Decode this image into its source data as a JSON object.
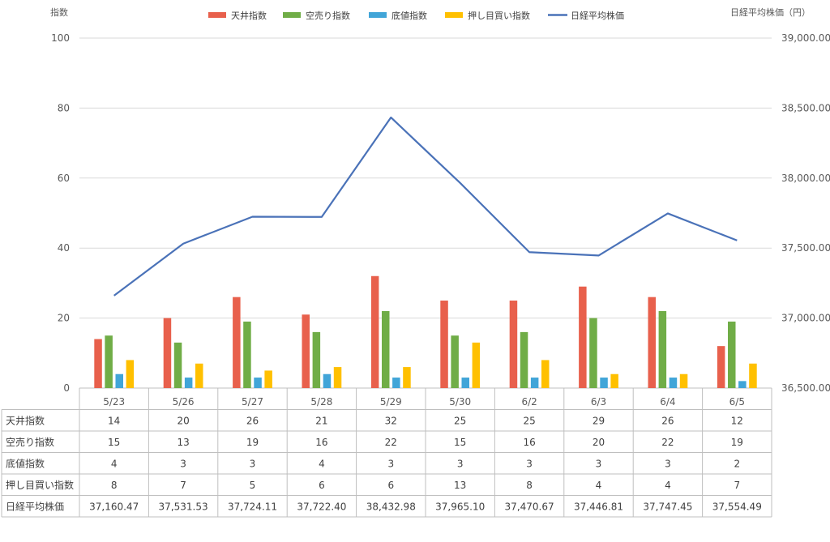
{
  "chart_data": {
    "type": "bar+line",
    "left_axis_title": "指数",
    "right_axis_title": "日経平均株価（円）",
    "categories": [
      "5/23",
      "5/26",
      "5/27",
      "5/28",
      "5/29",
      "5/30",
      "6/2",
      "6/3",
      "6/4",
      "6/5"
    ],
    "left_ylim": [
      0,
      100
    ],
    "left_ticks": [
      0,
      20,
      40,
      60,
      80,
      100
    ],
    "right_ylim": [
      36500,
      39000
    ],
    "right_ticks": [
      "36,500.00",
      "37,000.00",
      "37,500.00",
      "38,000.00",
      "38,500.00",
      "39,000.00"
    ],
    "right_tick_values": [
      36500,
      37000,
      37500,
      38000,
      38500,
      39000
    ],
    "grid": true,
    "legend_position": "top",
    "series": [
      {
        "name": "天井指数",
        "kind": "bar",
        "color": "#e8604c",
        "values": [
          14,
          20,
          26,
          21,
          32,
          25,
          25,
          29,
          26,
          12
        ]
      },
      {
        "name": "空売り指数",
        "kind": "bar",
        "color": "#70ad47",
        "values": [
          15,
          13,
          19,
          16,
          22,
          15,
          16,
          20,
          22,
          19
        ]
      },
      {
        "name": "底値指数",
        "kind": "bar",
        "color": "#41a5d8",
        "values": [
          4,
          3,
          3,
          4,
          3,
          3,
          3,
          3,
          3,
          2
        ]
      },
      {
        "name": "押し目買い指数",
        "kind": "bar",
        "color": "#ffc000",
        "values": [
          8,
          7,
          5,
          6,
          6,
          13,
          8,
          4,
          4,
          7
        ]
      },
      {
        "name": "日経平均株価",
        "kind": "line",
        "axis": "right",
        "color": "#4a72b8",
        "values": [
          37160.47,
          37531.53,
          37724.11,
          37722.4,
          38432.98,
          37965.1,
          37470.67,
          37446.81,
          37747.45,
          37554.49
        ],
        "labels": [
          "37,160.47",
          "37,531.53",
          "37,724.11",
          "37,722.40",
          "38,432.98",
          "37,965.10",
          "37,470.67",
          "37,446.81",
          "37,747.45",
          "37,554.49"
        ]
      }
    ]
  }
}
